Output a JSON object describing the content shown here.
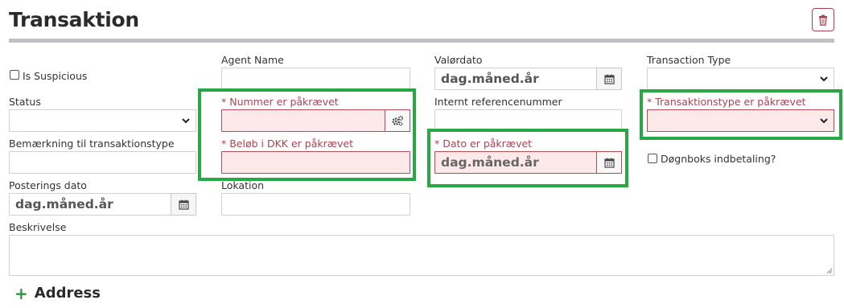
{
  "page": {
    "title": "Transaktion",
    "delete_icon": "trash-icon"
  },
  "fields": {
    "is_suspicious": {
      "label": "Is Suspicious",
      "checked": false
    },
    "agent_name": {
      "label": "Agent Name",
      "value": ""
    },
    "valoerdato": {
      "label": "Valørdato",
      "value": "dag.måned.år",
      "icon": "calendar-icon"
    },
    "transaction_type": {
      "label": "Transaction Type",
      "value": ""
    },
    "status": {
      "label": "Status",
      "value": ""
    },
    "nummer": {
      "label": "* Nummer er påkrævet",
      "value": "",
      "icon": "gears-icon"
    },
    "internt_ref": {
      "label": "Internt referencenummer",
      "value": ""
    },
    "transaktionstype": {
      "label": "* Transaktionstype er påkrævet",
      "value": ""
    },
    "bemaerkning": {
      "label": "Bemærkning til transaktionstype",
      "value": ""
    },
    "beloeb": {
      "label": "* Beløb i DKK er påkrævet",
      "value": ""
    },
    "dato": {
      "label": "* Dato er påkrævet",
      "value": "dag.måned.år",
      "icon": "calendar-icon"
    },
    "doegnboks": {
      "label": "Døgnboks indbetaling?",
      "checked": false
    },
    "posterings_dato": {
      "label": "Posterings dato",
      "value": "dag.måned.år",
      "icon": "calendar-icon"
    },
    "lokation": {
      "label": "Lokation",
      "value": ""
    },
    "beskrivelse": {
      "label": "Beskrivelse",
      "value": ""
    }
  },
  "address": {
    "label": "Address",
    "icon": "plus-icon"
  },
  "colors": {
    "required": "#a94452",
    "error_bg": "#fde8ea",
    "highlight": "#27a844",
    "accent_plus": "#2a9a3a"
  }
}
